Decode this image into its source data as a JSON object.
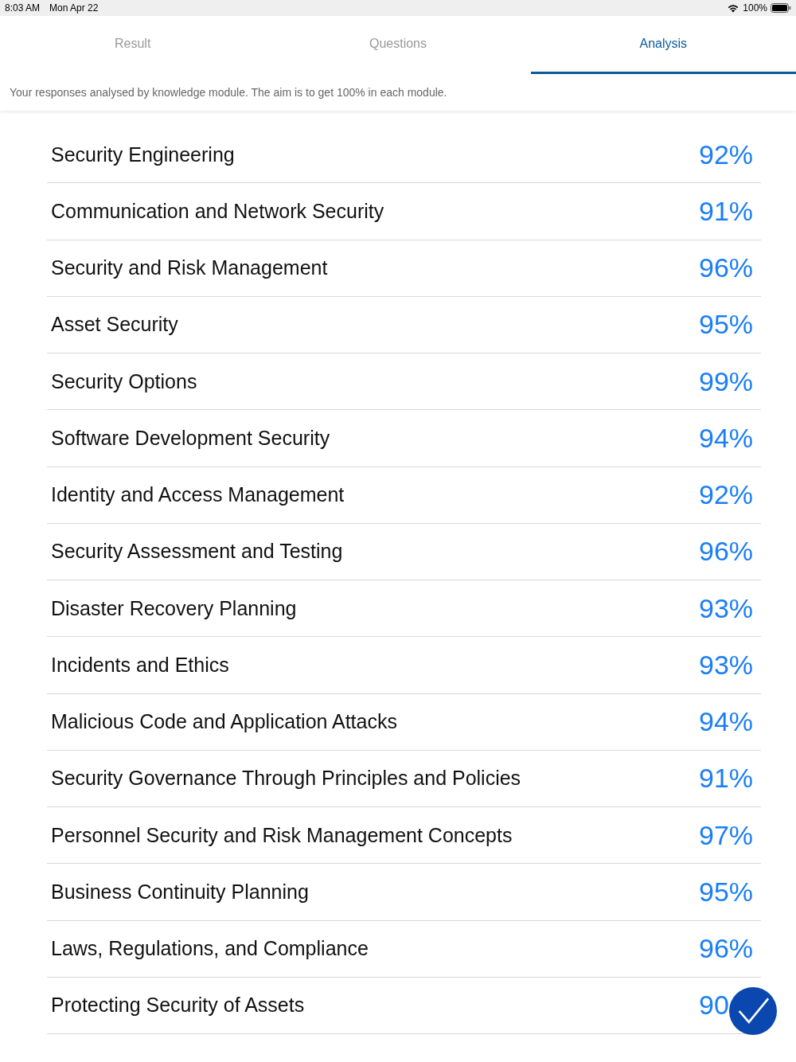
{
  "status_bar": {
    "time": "8:03 AM",
    "date": "Mon Apr 22",
    "battery": "100%"
  },
  "tabs": [
    {
      "label": "Result",
      "selected": false
    },
    {
      "label": "Questions",
      "selected": false
    },
    {
      "label": "Analysis",
      "selected": true
    }
  ],
  "description": "Your responses analysed by knowledge module. The aim is to get 100% in each module.",
  "modules": [
    {
      "name": "Security Engineering",
      "score": "92%"
    },
    {
      "name": "Communication and Network Security",
      "score": "91%"
    },
    {
      "name": "Security and Risk Management",
      "score": "96%"
    },
    {
      "name": "Asset Security",
      "score": "95%"
    },
    {
      "name": "Security Options",
      "score": "99%"
    },
    {
      "name": "Software Development Security",
      "score": "94%"
    },
    {
      "name": "Identity and Access Management",
      "score": "92%"
    },
    {
      "name": "Security Assessment and Testing",
      "score": "96%"
    },
    {
      "name": "Disaster Recovery Planning",
      "score": "93%"
    },
    {
      "name": "Incidents and Ethics",
      "score": "93%"
    },
    {
      "name": "Malicious Code and Application Attacks",
      "score": "94%"
    },
    {
      "name": "Security Governance Through Principles and Policies",
      "score": "91%"
    },
    {
      "name": "Personnel Security and Risk Management Concepts",
      "score": "97%"
    },
    {
      "name": "Business Continuity Planning",
      "score": "95%"
    },
    {
      "name": "Laws, Regulations, and Compliance",
      "score": "96%"
    },
    {
      "name": "Protecting Security of Assets",
      "score": "90"
    }
  ]
}
